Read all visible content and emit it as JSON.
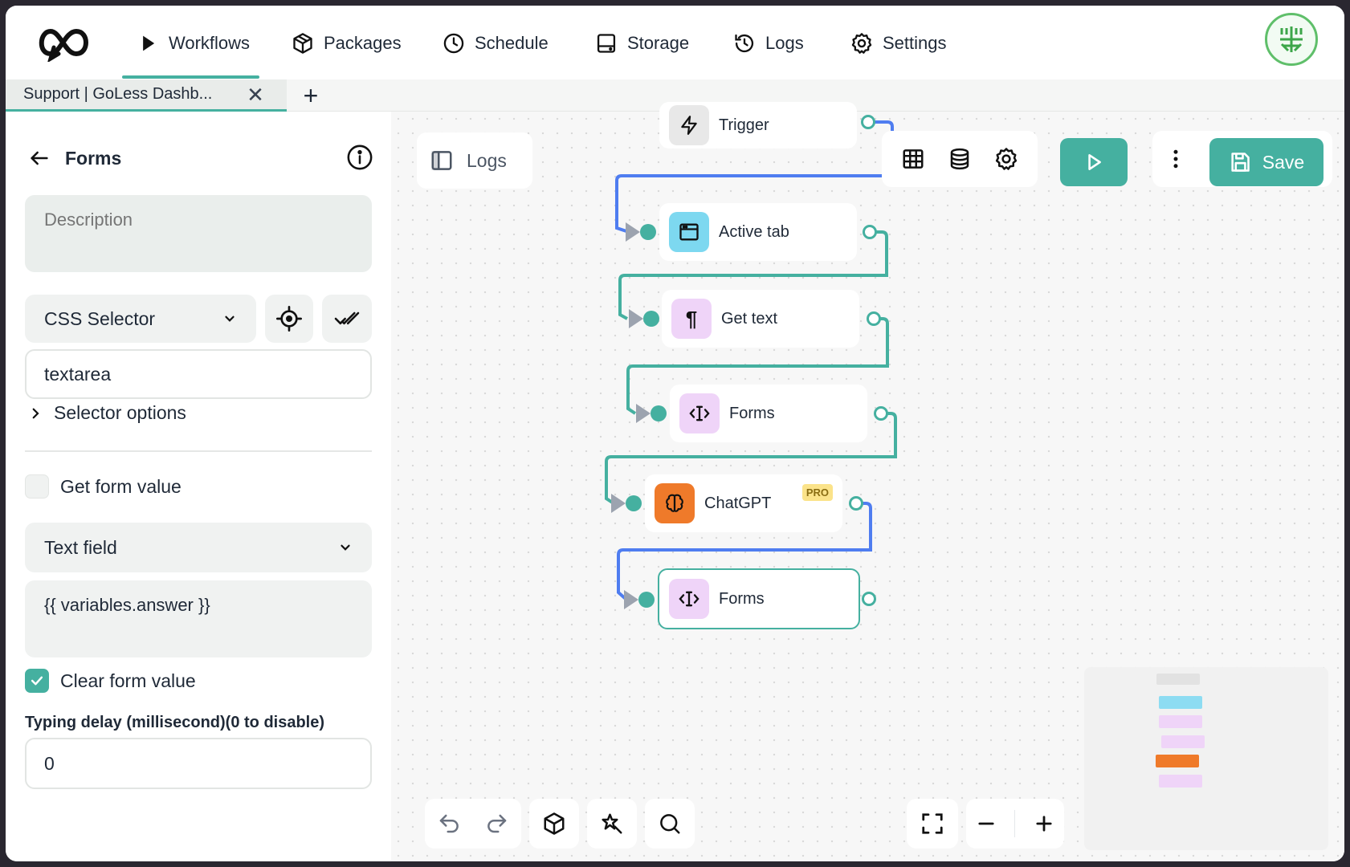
{
  "nav": {
    "items": [
      {
        "label": "Workflows",
        "icon": "play-icon"
      },
      {
        "label": "Packages",
        "icon": "package-icon"
      },
      {
        "label": "Schedule",
        "icon": "clock-icon"
      },
      {
        "label": "Storage",
        "icon": "storage-icon"
      },
      {
        "label": "Logs",
        "icon": "history-icon"
      },
      {
        "label": "Settings",
        "icon": "gear-icon"
      }
    ],
    "active": "Workflows"
  },
  "tabs": {
    "items": [
      {
        "label": "Support | GoLess Dashb..."
      }
    ],
    "close": "✕",
    "add": "+"
  },
  "panel": {
    "title": "Forms",
    "description_placeholder": "Description",
    "selector_type": "CSS Selector",
    "selector_value": "textarea",
    "selector_options_label": "Selector options",
    "get_form_value_label": "Get form value",
    "get_form_value_checked": false,
    "field_type": "Text field",
    "value": "{{ variables.answer }}",
    "clear_form_value_label": "Clear form value",
    "clear_form_value_checked": true,
    "typing_delay_label": "Typing delay (millisecond)(0 to disable)",
    "typing_delay_value": "0"
  },
  "canvas": {
    "logs_label": "Logs",
    "save_label": "Save",
    "nodes": [
      {
        "label": "Trigger",
        "color": "#e8e8e8"
      },
      {
        "label": "Active tab",
        "color": "#7dd8f0"
      },
      {
        "label": "Get text",
        "color": "#efd4f8"
      },
      {
        "label": "Forms",
        "color": "#efd4f8"
      },
      {
        "label": "ChatGPT",
        "color": "#ef7a2a",
        "badge": "PRO"
      },
      {
        "label": "Forms",
        "color": "#efd4f8"
      }
    ]
  },
  "colors": {
    "accent": "#45b0a0",
    "edge_blue": "#4f7df0"
  }
}
